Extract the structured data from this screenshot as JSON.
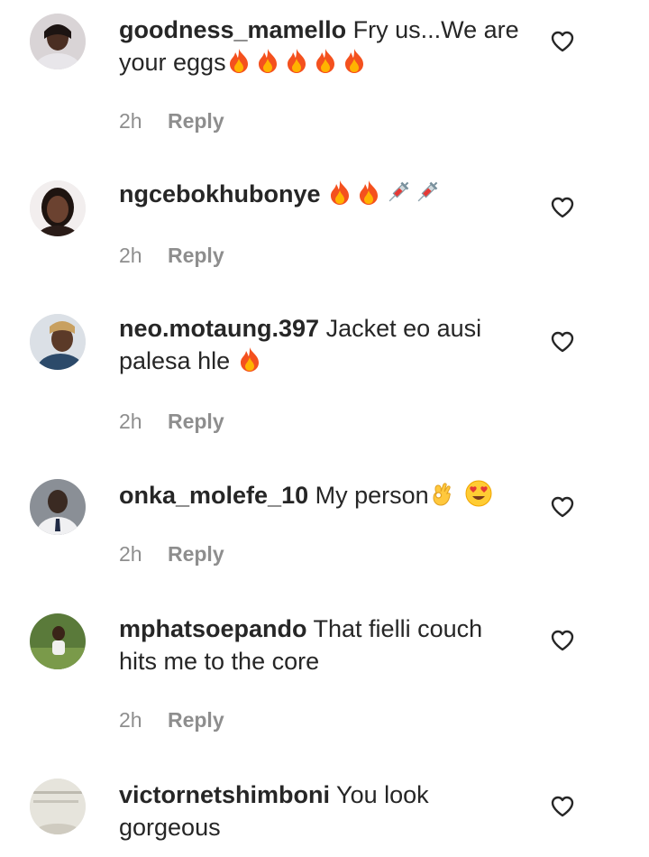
{
  "comments": [
    {
      "username": "goodness_mamello",
      "text": "Fry us...We are your eggs",
      "emojis": [
        "fire",
        "fire",
        "fire",
        "fire",
        "fire"
      ],
      "time": "2h",
      "reply_label": "Reply"
    },
    {
      "username": "ngcebokhubonye",
      "text": "",
      "emojis": [
        "fire",
        "fire",
        "syringe",
        "syringe"
      ],
      "time": "2h",
      "reply_label": "Reply"
    },
    {
      "username": "neo.motaung.397",
      "text": "Jacket eo ausi palesa hle",
      "emojis": [
        "fire"
      ],
      "time": "2h",
      "reply_label": "Reply"
    },
    {
      "username": "onka_molefe_10",
      "text": "My person",
      "emojis": [
        "ok-hand",
        "heart-eyes"
      ],
      "time": "2h",
      "reply_label": "Reply"
    },
    {
      "username": "mphatsoepando",
      "text": "That fielli couch hits me to the core",
      "emojis": [],
      "time": "2h",
      "reply_label": "Reply"
    },
    {
      "username": "victornetshimboni",
      "text": "You look gorgeous",
      "emojis": [],
      "time": "",
      "reply_label": ""
    }
  ],
  "colors": {
    "text": "#262626",
    "secondary": "#8e8e8e",
    "background": "#ffffff"
  },
  "icons": {
    "like": "heart-outline-icon",
    "fire": "fire-emoji",
    "syringe": "syringe-emoji",
    "ok_hand": "ok-hand-emoji",
    "heart_eyes": "heart-eyes-emoji"
  }
}
